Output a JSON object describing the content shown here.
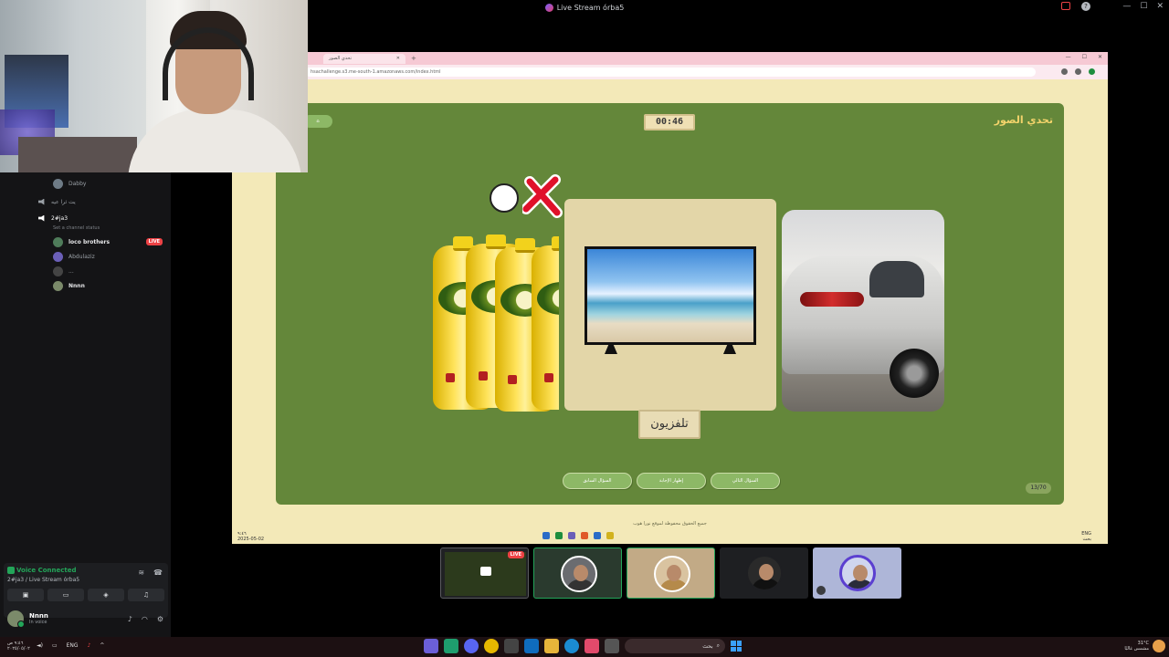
{
  "window": {
    "title": "Live Stream órba5"
  },
  "sidebar": {
    "top_user": "Dabby",
    "channel_idle": "يت ثرا عيه",
    "active_channel": "2#ja3",
    "channel_status": "Set a channel status",
    "users": [
      {
        "name": "loco brothers",
        "live": "LIVE"
      },
      {
        "name": "Abdulaziz"
      },
      {
        "name": "..."
      },
      {
        "name": "Nnnn"
      }
    ],
    "voice": {
      "connected": "Voice Connected",
      "location": "2#ja3 / Live Stream órba5"
    },
    "me": {
      "name": "Nnnn",
      "status": "In voice"
    }
  },
  "browser": {
    "tab_title": "تحدي الصور",
    "url": "hsachallenge.s3.me-south-1.amazonaws.com/index.html"
  },
  "game": {
    "title": "تحدي الصور",
    "timer": "00:46",
    "answer": "تلفزيون",
    "buttons": {
      "prev": "السؤال السابق",
      "reveal": "إظهار الإجابة",
      "next": "السؤال التالي"
    },
    "counter": "13/70",
    "footer": "جميع الحقوق محفوظة لموقع نورا هوب"
  },
  "inner_taskbar": {
    "time": "٩:٤٦",
    "date": "2025-05-02",
    "lang": "ENG",
    "search": "بحث"
  },
  "participants": {
    "live_label": "LIVE"
  },
  "taskbar": {
    "time": "٩:٤٦ ص",
    "date": "٢٠٢٥/٠٥/٠٢",
    "lang": "ENG",
    "search": "بحث",
    "weather": "31°C",
    "weather_desc": "مشمس غالبًا"
  },
  "colors": {
    "game_bg": "#64873a",
    "page_bg": "#f3e9b8",
    "title": "#f3d36b",
    "accent_green": "#23a559"
  }
}
